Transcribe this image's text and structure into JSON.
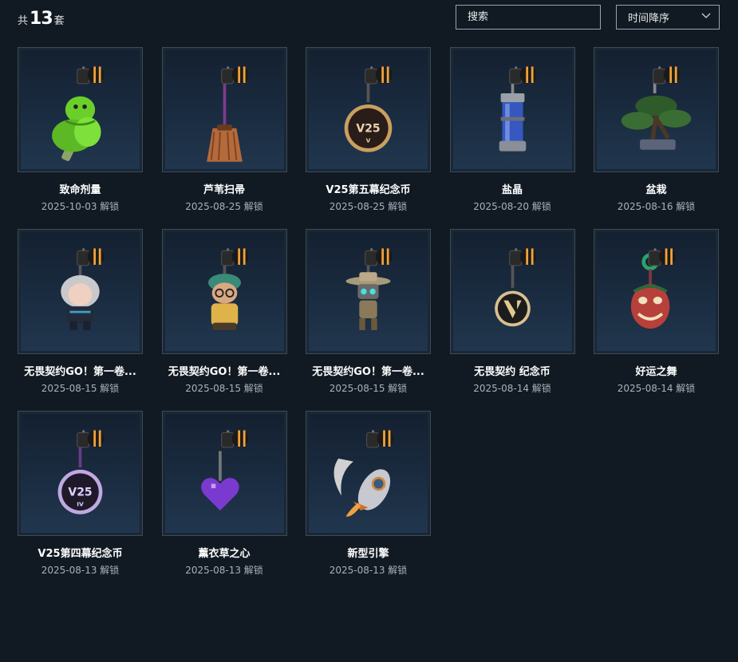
{
  "header": {
    "count_prefix": "共",
    "count_value": "13",
    "count_suffix": "套",
    "search_placeholder": "搜索",
    "sort_label": "时间降序"
  },
  "items": [
    {
      "name": "致命剂量",
      "date": "2025-10-03 解锁",
      "icon": "green-snake-vial-icon"
    },
    {
      "name": "芦苇扫帚",
      "date": "2025-08-25 解锁",
      "icon": "broom-icon"
    },
    {
      "name": "V25第五幕纪念币",
      "date": "2025-08-25 解锁",
      "icon": "v25-act5-coin-icon"
    },
    {
      "name": "盐晶",
      "date": "2025-08-20 解锁",
      "icon": "salt-crystal-tube-icon"
    },
    {
      "name": "盆栽",
      "date": "2025-08-16 解锁",
      "icon": "bonsai-icon"
    },
    {
      "name": "无畏契约GO！第一卷...",
      "date": "2025-08-15 解锁",
      "icon": "agent-chibi-white-hair-icon"
    },
    {
      "name": "无畏契约GO！第一卷...",
      "date": "2025-08-15 解锁",
      "icon": "agent-chibi-beanie-icon"
    },
    {
      "name": "无畏契约GO！第一卷...",
      "date": "2025-08-15 解锁",
      "icon": "agent-chibi-robot-hat-icon"
    },
    {
      "name": "无畏契约 纪念币",
      "date": "2025-08-14 解锁",
      "icon": "valorant-coin-icon"
    },
    {
      "name": "好运之舞",
      "date": "2025-08-14 解锁",
      "icon": "lion-dance-mask-icon"
    },
    {
      "name": "V25第四幕纪念币",
      "date": "2025-08-13 解锁",
      "icon": "v25-act4-coin-icon"
    },
    {
      "name": "薰衣草之心",
      "date": "2025-08-13 解锁",
      "icon": "lavender-heart-icon"
    },
    {
      "name": "新型引擎",
      "date": "2025-08-13 解锁",
      "icon": "rocket-engine-icon"
    }
  ],
  "colors": {
    "background": "#111a23",
    "card_border": "#3d4a57",
    "accent_gold": "#f2a23a"
  }
}
